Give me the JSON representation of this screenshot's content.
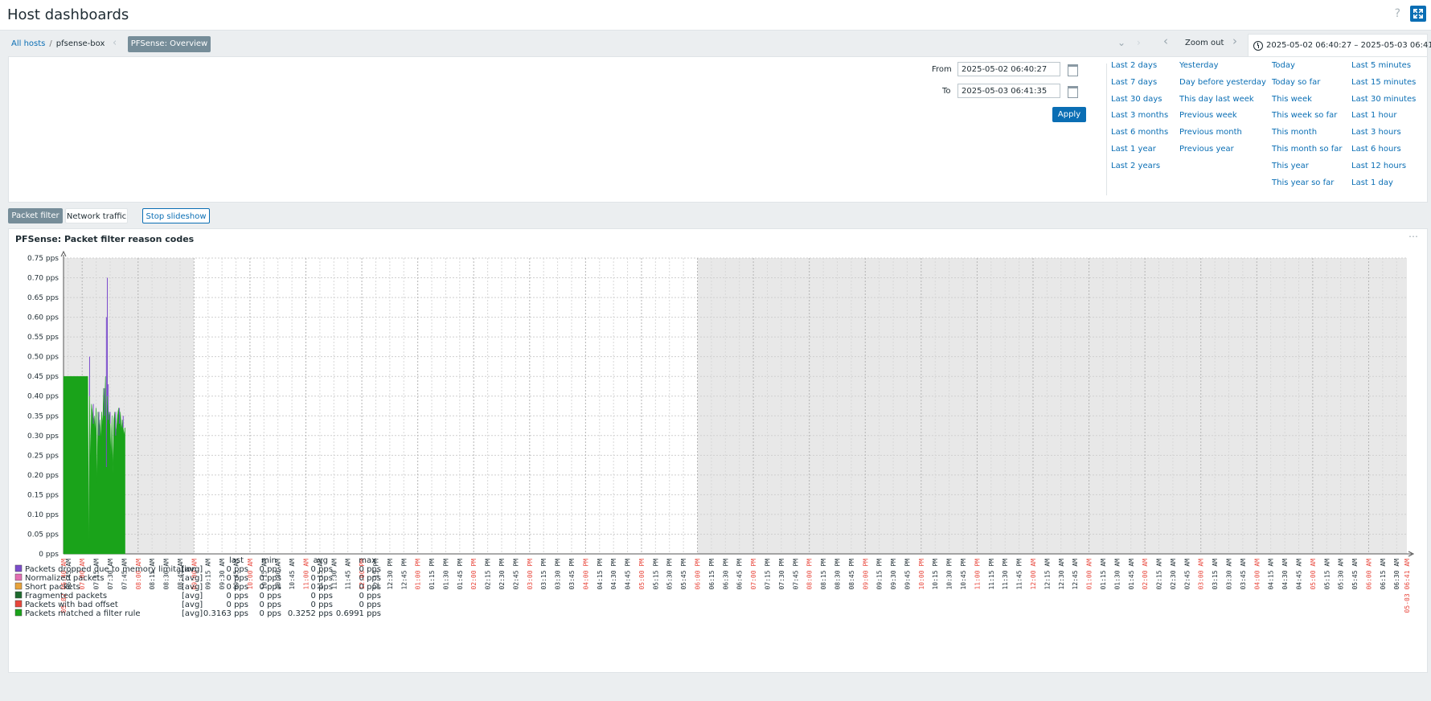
{
  "page": {
    "title": "Host dashboards"
  },
  "breadcrumb": {
    "all_hosts": "All hosts",
    "separator": "/",
    "host": "pfsense-box"
  },
  "dashboard": {
    "name": "PFSense: Overview"
  },
  "timeline": {
    "zoom_out": "Zoom out",
    "range": "2025-05-02 06:40:27 – 2025-05-03 06:41:35"
  },
  "time_filter": {
    "from_label": "From",
    "from_value": "2025-05-02 06:40:27",
    "to_label": "To",
    "to_value": "2025-05-03 06:41:35",
    "apply": "Apply",
    "quick": [
      [
        "Last 2 days",
        "Last 7 days",
        "Last 30 days",
        "Last 3 months",
        "Last 6 months",
        "Last 1 year",
        "Last 2 years"
      ],
      [
        "Yesterday",
        "Day before yesterday",
        "This day last week",
        "Previous week",
        "Previous month",
        "Previous year"
      ],
      [
        "Today",
        "Today so far",
        "This week",
        "This week so far",
        "This month",
        "This month so far",
        "This year",
        "This year so far"
      ],
      [
        "Last 5 minutes",
        "Last 15 minutes",
        "Last 30 minutes",
        "Last 1 hour",
        "Last 3 hours",
        "Last 6 hours",
        "Last 12 hours",
        "Last 1 day"
      ]
    ]
  },
  "pages": {
    "tab1": "Packet filter",
    "tab2": "Network traffic",
    "slideshow": "Stop slideshow"
  },
  "widget": {
    "title": "PFSense: Packet filter reason codes",
    "menu_icon": "ellipsis-icon"
  },
  "colors": {
    "accent": "#0a6eb4",
    "red_label": "#e8463b",
    "series_green": "#1aa31a",
    "series_purple": "#7c4dcc"
  },
  "chart_data": {
    "type": "area",
    "title": "PFSense: Packet filter reason codes",
    "unit": "pps",
    "ylim": [
      0,
      0.75
    ],
    "yticks": [
      "0 pps",
      "0.05 pps",
      "0.10 pps",
      "0.15 pps",
      "0.20 pps",
      "0.25 pps",
      "0.30 pps",
      "0.35 pps",
      "0.40 pps",
      "0.45 pps",
      "0.50 pps",
      "0.55 pps",
      "0.60 pps",
      "0.65 pps",
      "0.70 pps",
      "0.75 pps"
    ],
    "x_start": "05-02 06:40 AM",
    "x_end": "05-03 06:41 AM",
    "x_ticks_every_minutes": 15,
    "grid": true,
    "shaded_ranges": [
      [
        "05-02 06:40 AM",
        "05-02 09:00 AM"
      ],
      [
        "05-02 06:00 PM",
        "05-03 06:41 AM"
      ]
    ],
    "legend_headers": [
      "last",
      "min",
      "avg",
      "max"
    ],
    "legend": [
      {
        "name": "Packets dropped due to memory limitation",
        "color": "#7c4dcc",
        "func": "[avg]",
        "last": "0 pps",
        "min": "0 pps",
        "avg": "0 pps",
        "max": "0 pps"
      },
      {
        "name": "Normalized packets",
        "color": "#e46fb2",
        "func": "[avg]",
        "last": "0 pps",
        "min": "0 pps",
        "avg": "0 pps",
        "max": "0 pps"
      },
      {
        "name": "Short packets",
        "color": "#e8a33b",
        "func": "[avg]",
        "last": "0 pps",
        "min": "0 pps",
        "avg": "0 pps",
        "max": "0 pps"
      },
      {
        "name": "Fragmented packets",
        "color": "#1e6b2e",
        "func": "[avg]",
        "last": "0 pps",
        "min": "0 pps",
        "avg": "0 pps",
        "max": "0 pps"
      },
      {
        "name": "Packets with bad offset",
        "color": "#e8463b",
        "func": "[avg]",
        "last": "0 pps",
        "min": "0 pps",
        "avg": "0 pps",
        "max": "0 pps"
      },
      {
        "name": "Packets matched a filter rule",
        "color": "#1aa31a",
        "func": "[avg]",
        "last": "0.3163 pps",
        "min": "0 pps",
        "avg": "0.3252 pps",
        "max": "0.6991 pps"
      }
    ],
    "series": [
      {
        "name": "Packets matched a filter rule",
        "x_minutes": [
          0,
          1,
          2,
          3,
          5,
          7,
          9,
          10,
          11,
          12,
          13,
          14,
          15,
          16,
          17,
          18,
          19,
          20,
          21,
          22,
          23,
          24,
          25,
          26,
          27,
          28,
          29,
          30,
          31,
          32,
          33,
          34,
          35,
          36,
          37,
          38,
          39,
          40,
          41,
          42,
          43,
          44,
          45,
          46,
          47,
          48,
          49,
          50,
          51,
          52,
          53,
          54,
          55,
          56,
          57,
          58,
          59,
          60,
          61,
          62,
          63,
          64,
          65,
          66
        ],
        "values": [
          0.45,
          0.45,
          0.45,
          0.45,
          0.45,
          0.45,
          0.45,
          0.45,
          0.45,
          0.45,
          0.45,
          0.45,
          0.45,
          0.45,
          0.45,
          0.45,
          0.45,
          0.45,
          0.45,
          0.45,
          0.45,
          0.45,
          0.45,
          0.45,
          0.0,
          0.4,
          0.23,
          0.38,
          0.36,
          0.33,
          0.35,
          0.31,
          0.37,
          0.18,
          0.36,
          0.3,
          0.34,
          0.29,
          0.36,
          0.32,
          0.42,
          0.35,
          0.45,
          0.22,
          0.4,
          0.34,
          0.36,
          0.33,
          0.24,
          0.35,
          0.2,
          0.34,
          0.36,
          0.3,
          0.32,
          0.35,
          0.37,
          0.33,
          0.36,
          0.31,
          0.34,
          0.32,
          0.3,
          0.32
        ]
      },
      {
        "name": "Packets dropped due to memory limitation",
        "x_minutes": [
          26,
          28,
          32,
          38,
          44,
          46,
          47,
          48,
          50,
          56,
          60,
          64
        ],
        "values": [
          0.4,
          0.5,
          0.38,
          0.36,
          0.42,
          0.6,
          0.7,
          0.43,
          0.36,
          0.36,
          0.37,
          0.35
        ]
      }
    ]
  }
}
